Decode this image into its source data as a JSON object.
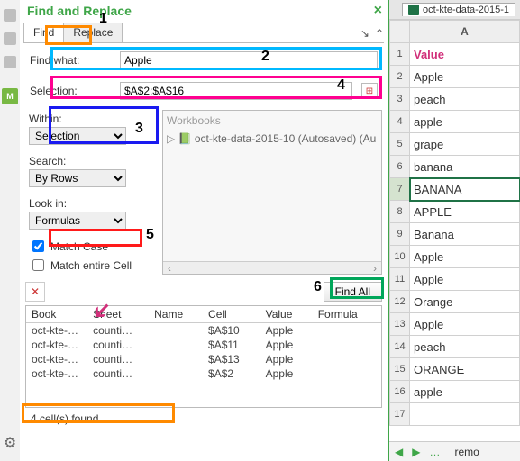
{
  "header": {
    "title": "Find and Replace"
  },
  "tabs": {
    "find": "Find",
    "replace": "Replace"
  },
  "findwhat": {
    "label": "Find what:",
    "value": "Apple"
  },
  "selection": {
    "label": "Selection:",
    "value": "$A$2:$A$16"
  },
  "within": {
    "label": "Within:",
    "value": "Selection"
  },
  "search": {
    "label": "Search:",
    "value": "By Rows"
  },
  "lookin": {
    "label": "Look in:",
    "value": "Formulas"
  },
  "matchcase": {
    "label": "Match Case",
    "checked": true
  },
  "matchcell": {
    "label": "Match entire Cell",
    "checked": false
  },
  "tree": {
    "title": "Workbooks",
    "workbook": "oct-kte-data-2015-10 (Autosaved) (Au"
  },
  "findall_label": "Find All",
  "results": {
    "headers": {
      "book": "Book",
      "sheet": "Sheet",
      "name": "Name",
      "cell": "Cell",
      "value": "Value",
      "formula": "Formula"
    },
    "rows": [
      {
        "book": "oct-kte-…",
        "sheet": "counti…",
        "name": "",
        "cell": "$A$10",
        "value": "Apple",
        "formula": ""
      },
      {
        "book": "oct-kte-…",
        "sheet": "counti…",
        "name": "",
        "cell": "$A$11",
        "value": "Apple",
        "formula": ""
      },
      {
        "book": "oct-kte-…",
        "sheet": "counti…",
        "name": "",
        "cell": "$A$13",
        "value": "Apple",
        "formula": ""
      },
      {
        "book": "oct-kte-…",
        "sheet": "counti…",
        "name": "",
        "cell": "$A$2",
        "value": "Apple",
        "formula": ""
      }
    ]
  },
  "status": "4 cell(s) found",
  "annotations": {
    "n1": "1",
    "n2": "2",
    "n3": "3",
    "n4": "4",
    "n5": "5",
    "n6": "6"
  },
  "sheet": {
    "tabname": "oct-kte-data-2015-1",
    "colA": "A",
    "rows": [
      "Value",
      "Apple",
      "peach",
      "apple",
      "grape",
      "banana",
      "BANANA",
      "APPLE",
      "Banana",
      "Apple",
      "Apple",
      "Orange",
      "Apple",
      "peach",
      "ORANGE",
      "apple",
      ""
    ],
    "footer_tab": "remo"
  }
}
